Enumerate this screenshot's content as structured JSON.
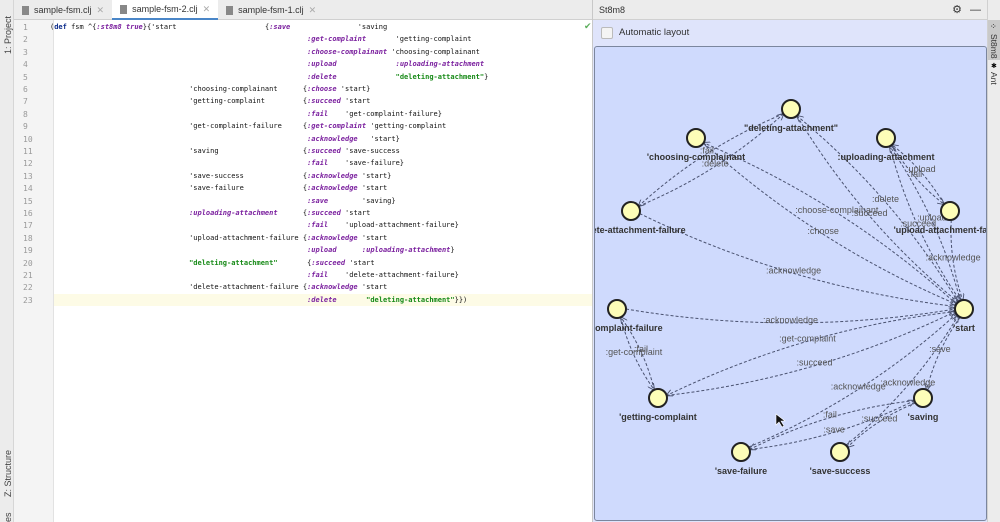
{
  "left_strip": {
    "project": "1: Project",
    "structure": "Z: Structure",
    "bottom": "es"
  },
  "tabs": [
    {
      "label": "sample-fsm.clj",
      "active": false
    },
    {
      "label": "sample-fsm-2.clj",
      "active": true
    },
    {
      "label": "sample-fsm-1.clj",
      "active": false
    }
  ],
  "editor": {
    "current_line": 23,
    "lines": [
      [
        [
          "(",
          "p"
        ],
        [
          "def",
          "d"
        ],
        [
          " fsm ^{",
          "p"
        ],
        [
          ":st8m8 true",
          "k"
        ],
        [
          "}{'start                     ",
          "p"
        ],
        [
          "{",
          ""
        ],
        [
          ":save",
          "k"
        ],
        [
          "                'saving",
          "p"
        ]
      ],
      [
        [
          "                                                             ",
          "p"
        ],
        [
          ":get-complaint",
          "k"
        ],
        [
          "       'getting-complaint",
          "p"
        ]
      ],
      [
        [
          "                                                             ",
          "p"
        ],
        [
          ":choose-complainant",
          "k"
        ],
        [
          " 'choosing-complainant",
          "p"
        ]
      ],
      [
        [
          "                                                             ",
          "p"
        ],
        [
          ":upload",
          "k"
        ],
        [
          "              ",
          "p"
        ],
        [
          ":uploading-attachment",
          "k"
        ]
      ],
      [
        [
          "                                                             ",
          "p"
        ],
        [
          ":delete",
          "k"
        ],
        [
          "              ",
          "p"
        ],
        [
          "\"deleting-attachment\"",
          "s"
        ],
        [
          "}",
          "p"
        ]
      ],
      [
        [
          "                                 'choosing-complainant      {",
          "p"
        ],
        [
          ":choose",
          "k"
        ],
        [
          " 'start}",
          "p"
        ]
      ],
      [
        [
          "                                 'getting-complaint         {",
          "p"
        ],
        [
          ":succeed",
          "k"
        ],
        [
          " 'start",
          "p"
        ]
      ],
      [
        [
          "                                                             ",
          "p"
        ],
        [
          ":fail",
          "k"
        ],
        [
          "    'get-complaint-failure}",
          "p"
        ]
      ],
      [
        [
          "                                 'get-complaint-failure     {",
          "p"
        ],
        [
          ":get-complaint",
          "k"
        ],
        [
          " 'getting-complaint",
          "p"
        ]
      ],
      [
        [
          "                                                             ",
          "p"
        ],
        [
          ":acknowledge",
          "k"
        ],
        [
          "   'start}",
          "p"
        ]
      ],
      [
        [
          "                                 'saving                    {",
          "p"
        ],
        [
          ":succeed",
          "k"
        ],
        [
          " 'save-success",
          "p"
        ]
      ],
      [
        [
          "                                                             ",
          "p"
        ],
        [
          ":fail",
          "k"
        ],
        [
          "    'save-failure}",
          "p"
        ]
      ],
      [
        [
          "                                 'save-success              {",
          "p"
        ],
        [
          ":acknowledge",
          "k"
        ],
        [
          " 'start}",
          "p"
        ]
      ],
      [
        [
          "                                 'save-failure              {",
          "p"
        ],
        [
          ":acknowledge",
          "k"
        ],
        [
          " 'start",
          "p"
        ]
      ],
      [
        [
          "                                                             ",
          "p"
        ],
        [
          ":save",
          "k"
        ],
        [
          "        'saving}",
          "p"
        ]
      ],
      [
        [
          "                                 ",
          "p"
        ],
        [
          ":uploading-attachment",
          "k"
        ],
        [
          "      {",
          "p"
        ],
        [
          ":succeed",
          "k"
        ],
        [
          " 'start",
          "p"
        ]
      ],
      [
        [
          "                                                             ",
          "p"
        ],
        [
          ":fail",
          "k"
        ],
        [
          "    'upload-attachment-failure}",
          "p"
        ]
      ],
      [
        [
          "                                 'upload-attachment-failure {",
          "p"
        ],
        [
          ":acknowledge",
          "k"
        ],
        [
          " 'start",
          "p"
        ]
      ],
      [
        [
          "                                                             ",
          "p"
        ],
        [
          ":upload",
          "k"
        ],
        [
          "      ",
          "p"
        ],
        [
          ":uploading-attachment",
          "k"
        ],
        [
          "}",
          "p"
        ]
      ],
      [
        [
          "                                 ",
          "p"
        ],
        [
          "\"deleting-attachment\"",
          "s"
        ],
        [
          "       {",
          "p"
        ],
        [
          ":succeed",
          "k"
        ],
        [
          " 'start",
          "p"
        ]
      ],
      [
        [
          "                                                             ",
          "p"
        ],
        [
          ":fail",
          "k"
        ],
        [
          "    'delete-attachment-failure}",
          "p"
        ]
      ],
      [
        [
          "                                 'delete-attachment-failure {",
          "p"
        ],
        [
          ":acknowledge",
          "k"
        ],
        [
          " 'start",
          "p"
        ]
      ],
      [
        [
          "                                                             ",
          "p"
        ],
        [
          ":delete",
          "k"
        ],
        [
          "       ",
          "p"
        ],
        [
          "\"deleting-attachment\"",
          "s"
        ],
        [
          "}})",
          "p"
        ]
      ]
    ]
  },
  "panel": {
    "title": "St8m8",
    "gear_icon": "gear-icon",
    "minimize_icon": "minimize-icon",
    "auto_layout_label": "Automatic layout",
    "auto_layout_checked": false
  },
  "right_strip": {
    "st8m8": "St8m8",
    "ant": "Ant"
  },
  "graph": {
    "node_fill": "#fdfdb8",
    "edge_color": "#4a5270",
    "nodes": [
      {
        "id": "deleting",
        "label": "\"deleting-attachment\""
      },
      {
        "id": "choosing",
        "label": "'choosing-complainant"
      },
      {
        "id": "uploading",
        "label": ":uploading-attachment"
      },
      {
        "id": "daf",
        "label": "'delete-attachment-failure"
      },
      {
        "id": "uaf",
        "label": "'upload-attachment-failure"
      },
      {
        "id": "start",
        "label": "'start"
      },
      {
        "id": "gcf",
        "label": "'get-complaint-failure"
      },
      {
        "id": "getting",
        "label": "'getting-complaint"
      },
      {
        "id": "saving",
        "label": "'saving"
      },
      {
        "id": "sfail",
        "label": "'save-failure"
      },
      {
        "id": "ssucc",
        "label": "'save-success"
      }
    ],
    "edges": [
      {
        "from": "start",
        "to": "saving",
        "label": ":save"
      },
      {
        "from": "start",
        "to": "getting",
        "label": ":get-complaint"
      },
      {
        "from": "start",
        "to": "choosing",
        "label": ":choose-complainant"
      },
      {
        "from": "start",
        "to": "uploading",
        "label": ":upload"
      },
      {
        "from": "start",
        "to": "deleting",
        "label": ":delete"
      },
      {
        "from": "choosing",
        "to": "start",
        "label": ":choose"
      },
      {
        "from": "getting",
        "to": "start",
        "label": ":succeed"
      },
      {
        "from": "getting",
        "to": "gcf",
        "label": ":fail"
      },
      {
        "from": "gcf",
        "to": "getting",
        "label": ":get-complaint"
      },
      {
        "from": "gcf",
        "to": "start",
        "label": ":acknowledge"
      },
      {
        "from": "saving",
        "to": "ssucc",
        "label": ":succeed"
      },
      {
        "from": "saving",
        "to": "sfail",
        "label": ":fail"
      },
      {
        "from": "ssucc",
        "to": "start",
        "label": ":acknowledge"
      },
      {
        "from": "sfail",
        "to": "start",
        "label": ":acknowledge"
      },
      {
        "from": "sfail",
        "to": "saving",
        "label": ":save"
      },
      {
        "from": "uploading",
        "to": "start",
        "label": ":succeed"
      },
      {
        "from": "uploading",
        "to": "uaf",
        "label": ":fail"
      },
      {
        "from": "uaf",
        "to": "start",
        "label": ":acknowledge"
      },
      {
        "from": "uaf",
        "to": "uploading",
        "label": ":upload"
      },
      {
        "from": "deleting",
        "to": "start",
        "label": ":succeed"
      },
      {
        "from": "deleting",
        "to": "daf",
        "label": ":fail"
      },
      {
        "from": "daf",
        "to": "start",
        "label": ":acknowledge"
      },
      {
        "from": "daf",
        "to": "deleting",
        "label": ":delete"
      }
    ]
  }
}
